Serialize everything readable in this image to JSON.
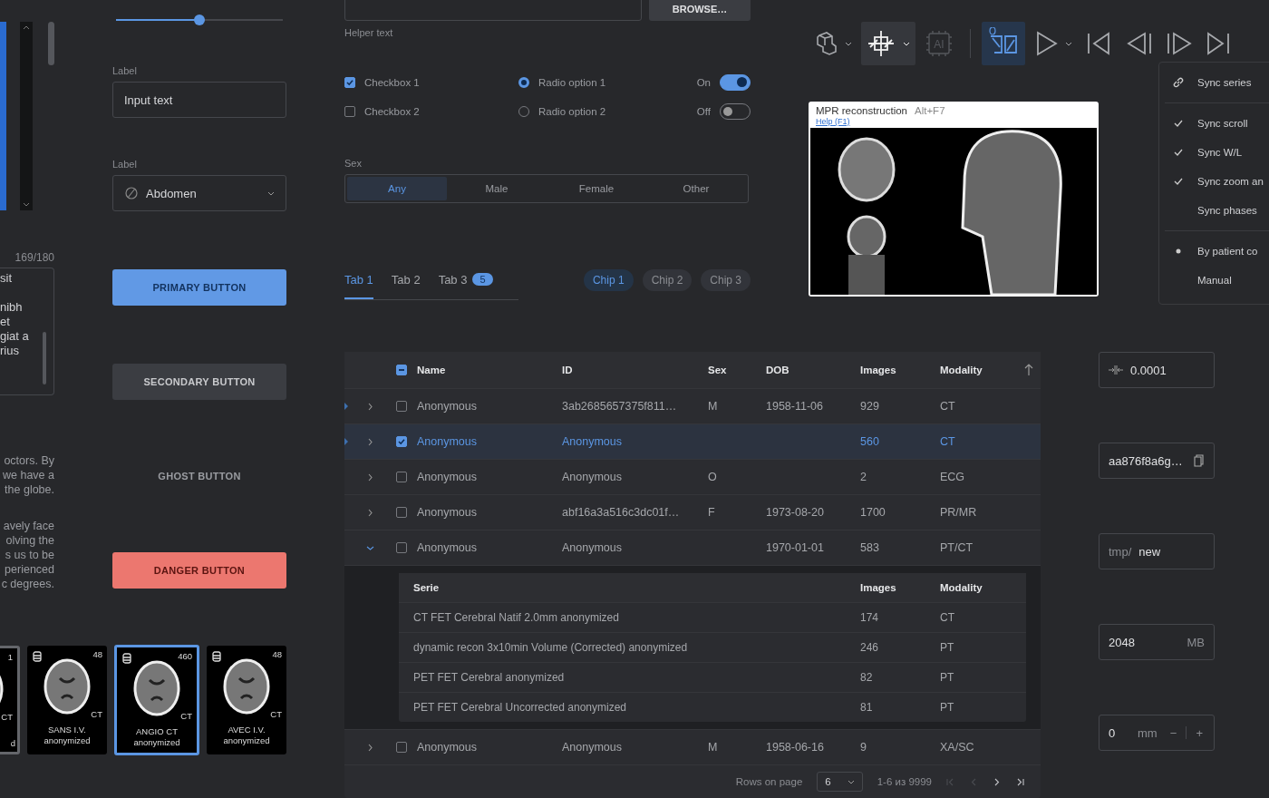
{
  "slider": {
    "level": 0.5
  },
  "textarea": {
    "counter": "169/180",
    "lines": [
      "sit",
      "nibh",
      "et",
      "giat a",
      "rius"
    ]
  },
  "paragraphs": [
    [
      "octors. By",
      "we have a",
      "the globe."
    ],
    [
      "avely face",
      "olving the",
      "s us to be",
      "perienced",
      "c degrees."
    ]
  ],
  "input": {
    "label": "Label",
    "value": "Input text"
  },
  "select": {
    "label": "Label",
    "value": "Abdomen"
  },
  "buttons": [
    {
      "kind": "primary",
      "label": "PRIMARY BUTTON"
    },
    {
      "kind": "secondary",
      "label": "SECONDARY BUTTON"
    },
    {
      "kind": "ghost",
      "label": "GHOST BUTTON"
    },
    {
      "kind": "danger",
      "label": "DANGER BUTTON"
    }
  ],
  "thumbnails": [
    {
      "count": "1",
      "modality": "CT",
      "caption": [
        "d"
      ],
      "hovered": true,
      "selected": false
    },
    {
      "count": "48",
      "modality": "CT",
      "caption": [
        "SANS I.V.",
        "anonymized"
      ],
      "hovered": false,
      "selected": false
    },
    {
      "count": "460",
      "modality": "CT",
      "caption": [
        "ANGIO CT",
        "anonymized"
      ],
      "hovered": false,
      "selected": true
    },
    {
      "count": "48",
      "modality": "CT",
      "caption": [
        "AVEC I.V.",
        "anonymized"
      ],
      "hovered": false,
      "selected": false
    }
  ],
  "file": {
    "button": "BROWSE…",
    "helper": "Helper text"
  },
  "checkboxes": [
    {
      "label": "Checkbox 1",
      "checked": true
    },
    {
      "label": "Checkbox 2",
      "checked": false
    }
  ],
  "radios": [
    {
      "label": "Radio option 1",
      "selected": true
    },
    {
      "label": "Radio option 2",
      "selected": false
    }
  ],
  "switches": [
    {
      "label": "On",
      "on": true
    },
    {
      "label": "Off",
      "on": false
    }
  ],
  "segmented": {
    "label": "Sex",
    "options": [
      {
        "label": "Any",
        "selected": true
      },
      {
        "label": "Male",
        "selected": false
      },
      {
        "label": "Female",
        "selected": false
      },
      {
        "label": "Other",
        "selected": false
      }
    ]
  },
  "tabs": [
    {
      "label": "Tab 1",
      "selected": true
    },
    {
      "label": "Tab 2",
      "selected": false
    },
    {
      "label": "Tab 3",
      "selected": false,
      "badge": "5"
    }
  ],
  "chips": [
    {
      "label": "Chip 1",
      "selected": true
    },
    {
      "label": "Chip 2",
      "selected": false
    },
    {
      "label": "Chip 3",
      "selected": false
    }
  ],
  "toolbar": [
    {
      "selected": false,
      "pressed": false,
      "disabled": false,
      "menu": true
    },
    {
      "selected": false,
      "pressed": true,
      "disabled": false,
      "menu": true
    },
    {
      "selected": false,
      "pressed": false,
      "disabled": true,
      "menu": false,
      "label": "AI"
    },
    {
      "selected": true,
      "pressed": false,
      "disabled": false,
      "menu": false
    },
    {
      "selected": false,
      "pressed": false,
      "disabled": false,
      "menu": true
    },
    {
      "selected": false,
      "pressed": false,
      "disabled": false,
      "menu": false
    },
    {
      "selected": false,
      "pressed": false,
      "disabled": false,
      "menu": false
    },
    {
      "selected": false,
      "pressed": false,
      "disabled": false,
      "menu": false
    },
    {
      "selected": false,
      "pressed": false,
      "disabled": false,
      "menu": false
    }
  ],
  "tooltip": {
    "title": "MPR reconstruction",
    "shortcut": "Alt+F7",
    "link": "Help (F1)"
  },
  "menu": [
    {
      "kind": "action",
      "label": "Sync series"
    },
    {
      "kind": "divider"
    },
    {
      "kind": "check",
      "label": "Sync scroll",
      "checked": true
    },
    {
      "kind": "check",
      "label": "Sync W/L",
      "checked": true
    },
    {
      "kind": "check",
      "label": "Sync zoom an",
      "checked": true
    },
    {
      "kind": "check",
      "label": "Sync phases",
      "checked": false
    },
    {
      "kind": "divider"
    },
    {
      "kind": "radio",
      "label": "By patient co",
      "selected": true
    },
    {
      "kind": "radio",
      "label": "Manual",
      "selected": false
    }
  ],
  "table": {
    "columns": [
      "Name",
      "ID",
      "Sex",
      "DOB",
      "Images",
      "Modality"
    ],
    "indeterminate": true,
    "rows": [
      {
        "marked": true,
        "expanded": false,
        "checked": false,
        "cells": {
          "name": "Anonymous",
          "id": "3ab2685657375f811…",
          "sex": "M",
          "dob": "1958-11-06",
          "images": "929",
          "modality": "CT"
        }
      },
      {
        "marked": true,
        "expanded": false,
        "checked": true,
        "cells": {
          "name": "Anonymous",
          "id": "Anonymous",
          "images": "560",
          "modality": "CT"
        }
      },
      {
        "marked": false,
        "expanded": false,
        "checked": false,
        "cells": {
          "name": "Anonymous",
          "id": "Anonymous",
          "sex": "O",
          "images": "2",
          "modality": "ECG"
        }
      },
      {
        "marked": false,
        "expanded": false,
        "checked": false,
        "cells": {
          "name": "Anonymous",
          "id": "abf16a3a516c3dc01f…",
          "sex": "F",
          "dob": "1973-08-20",
          "images": "1700",
          "modality": "PR/MR"
        }
      },
      {
        "marked": false,
        "expanded": true,
        "checked": false,
        "cells": {
          "name": "Anonymous",
          "id": "Anonymous",
          "dob": "1970-01-01",
          "images": "583",
          "modality": "PT/CT"
        },
        "series": {
          "columns": [
            "Serie",
            "Images",
            "Modality"
          ],
          "rows": [
            [
              "CT FET Cerebral Natif  2.0mm anonymized",
              "174",
              "CT"
            ],
            [
              "dynamic recon 3x10min Volume (Corrected) anonymized",
              "246",
              "PT"
            ],
            [
              "PET FET Cerebral anonymized",
              "82",
              "PT"
            ],
            [
              "PET FET Cerebral Uncorrected anonymized",
              "81",
              "PT"
            ]
          ]
        }
      },
      {
        "marked": false,
        "expanded": false,
        "checked": false,
        "cells": {
          "name": "Anonymous",
          "id": "Anonymous",
          "sex": "M",
          "dob": "1958-06-16",
          "images": "9",
          "modality": "XA/SC"
        }
      }
    ],
    "pagination": {
      "label": "Rows on page",
      "size": "6",
      "range": "1-6 из 9999",
      "pager": [
        {
          "disabled": true
        },
        {
          "disabled": true
        },
        {
          "disabled": false
        },
        {
          "disabled": false
        }
      ]
    }
  },
  "fields": [
    {
      "kind": "spacing",
      "value": "0.0001"
    },
    {
      "kind": "copy",
      "value": "aa876f8a6g…"
    },
    {
      "kind": "prefix",
      "prefix": "tmp/",
      "value": "new"
    },
    {
      "kind": "unit",
      "value": "2048",
      "unit": "MB"
    },
    {
      "kind": "stepper",
      "value": "0",
      "unit": "mm",
      "minus": "−",
      "plus": "+"
    }
  ]
}
